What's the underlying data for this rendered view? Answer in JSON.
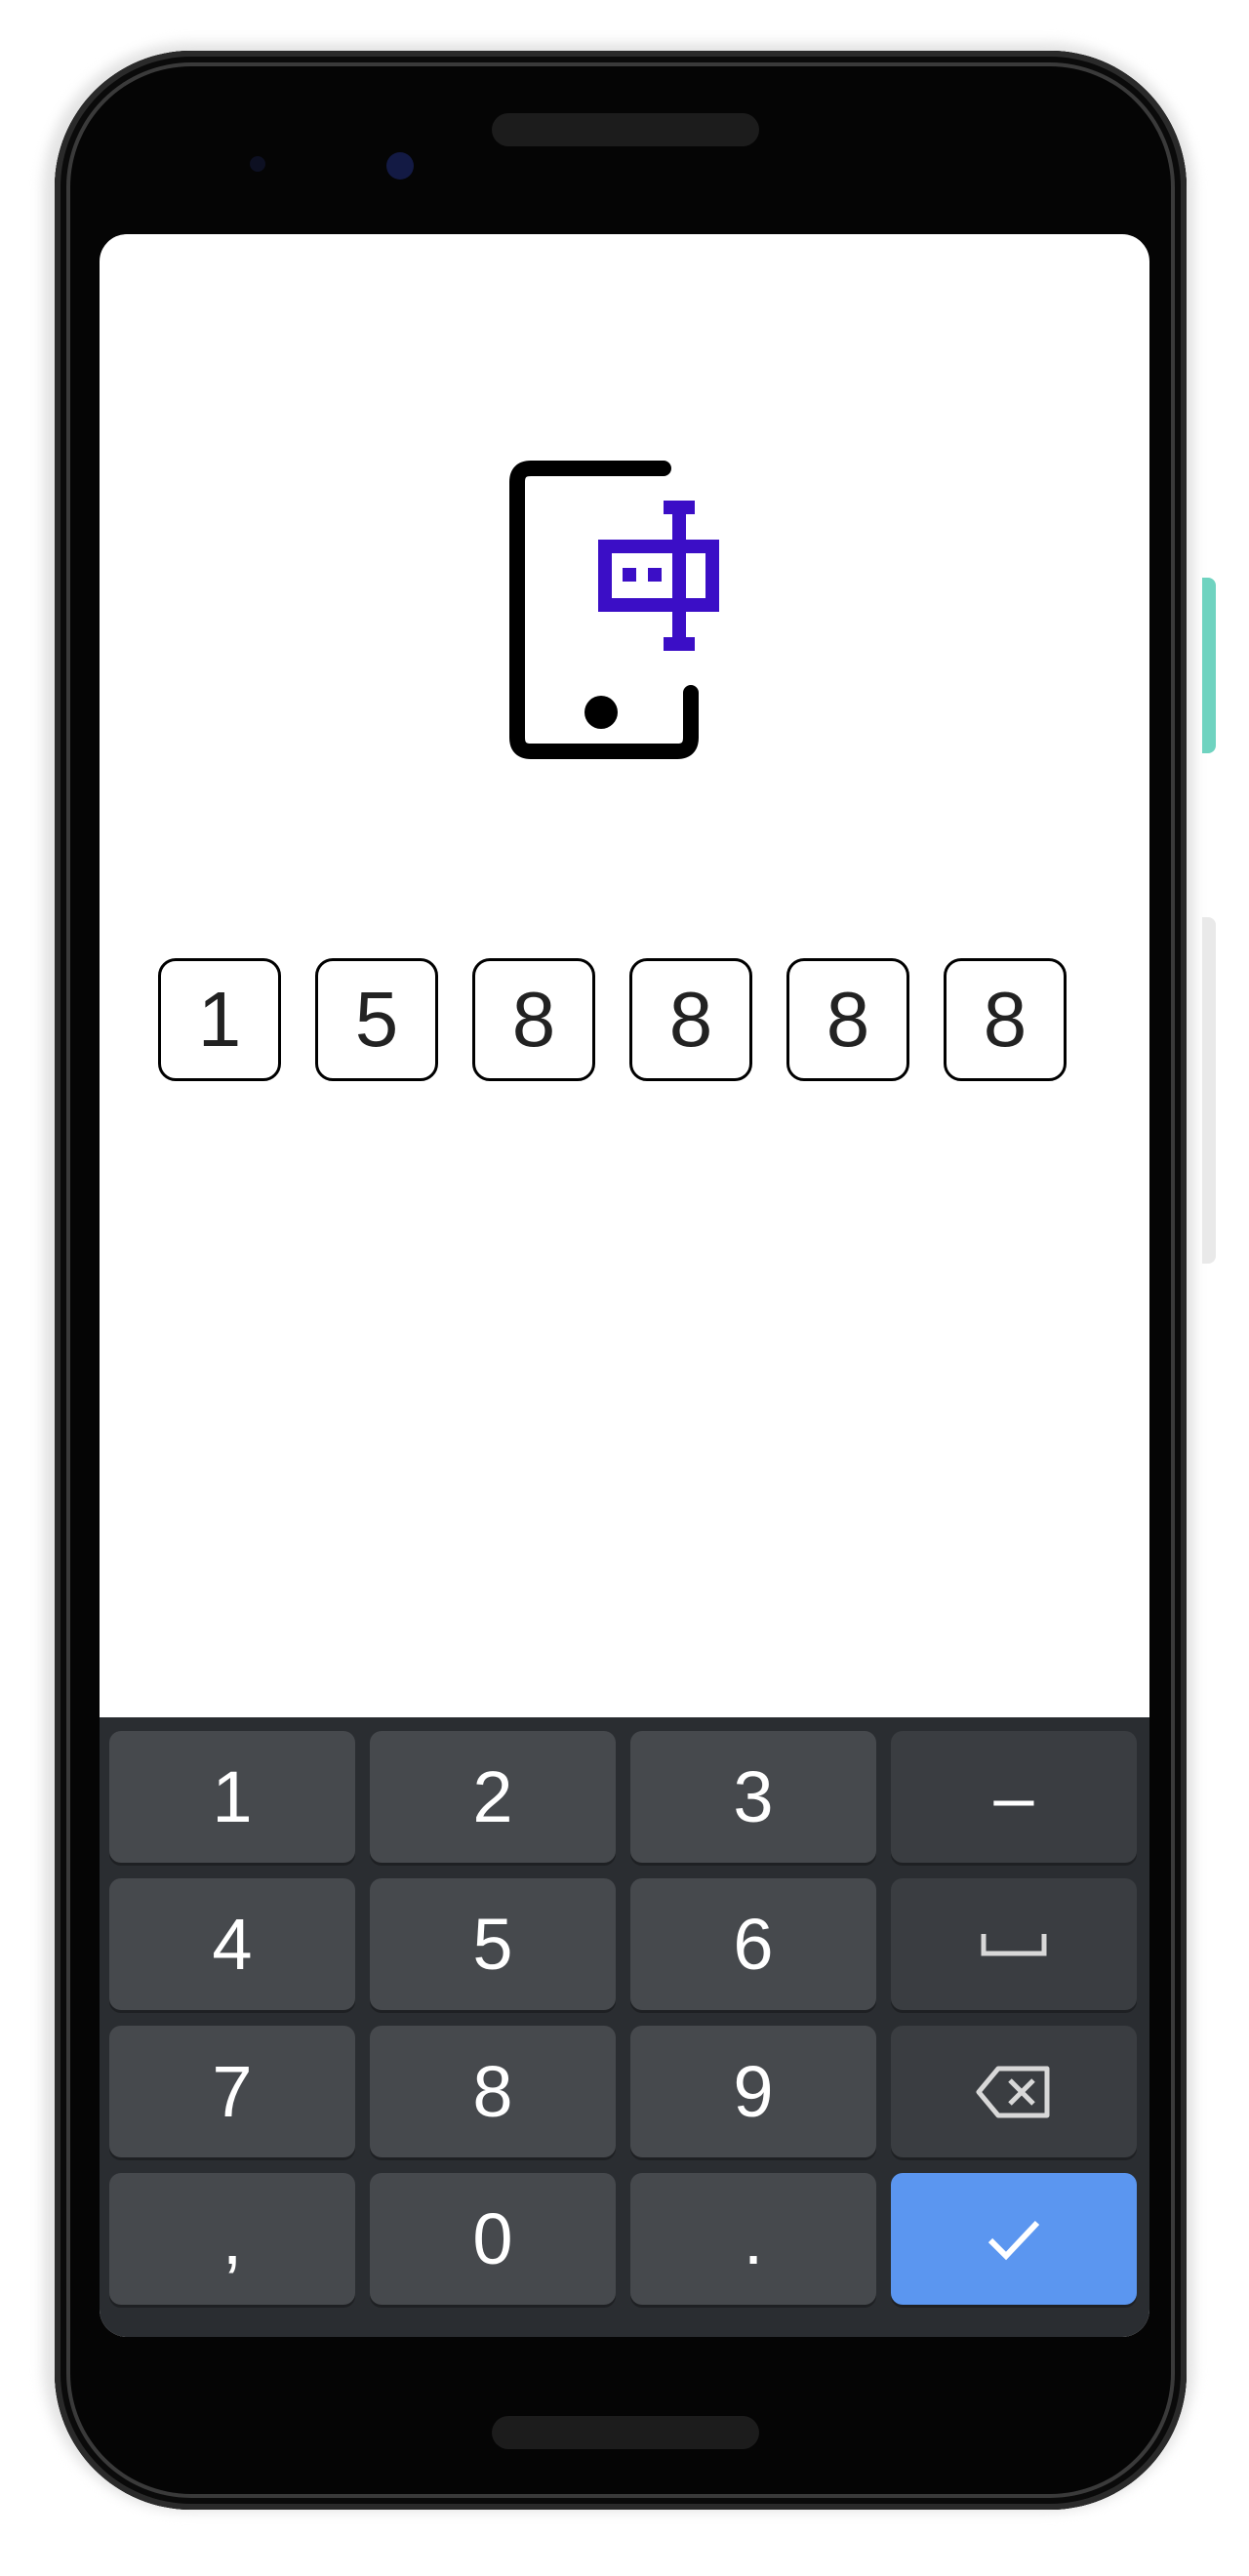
{
  "verification": {
    "code_digits": [
      "1",
      "5",
      "8",
      "8",
      "8",
      "8"
    ],
    "logo_color": "#3b0ec6"
  },
  "keyboard": {
    "keys": {
      "k1": "1",
      "k2": "2",
      "k3": "3",
      "k4": "4",
      "k5": "5",
      "k6": "6",
      "k7": "7",
      "k8": "8",
      "k9": "9",
      "comma": ",",
      "k0": "0",
      "period": ".",
      "minus": "–"
    },
    "icons": {
      "space": "space-bar-icon",
      "backspace": "backspace-icon",
      "enter": "check-icon"
    },
    "accent_color": "#5b96f0"
  }
}
